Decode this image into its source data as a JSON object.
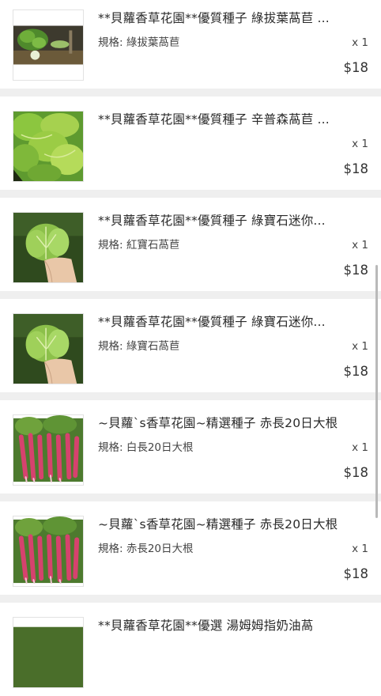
{
  "items": [
    {
      "title": "**貝蘿香草花園**優質種子 綠拔葉萵苣 ...",
      "spec": "規格: 綠拔葉萵苣",
      "qty": "x 1",
      "price": "$18",
      "image_icon": "green-leaf-lettuce-photo"
    },
    {
      "title": "**貝蘿香草花園**優質種子 辛普森萵苣 ...",
      "spec": "",
      "qty": "x 1",
      "price": "$18",
      "image_icon": "simpson-lettuce-photo"
    },
    {
      "title": "**貝蘿香草花園**優質種子 綠寶石迷你...",
      "spec": "規格: 紅寶石萵苣",
      "qty": "x 1",
      "price": "$18",
      "image_icon": "mini-romaine-photo"
    },
    {
      "title": "**貝蘿香草花園**優質種子 綠寶石迷你...",
      "spec": "規格: 綠寶石萵苣",
      "qty": "x 1",
      "price": "$18",
      "image_icon": "mini-romaine-photo"
    },
    {
      "title": "~貝蘿`s香草花園~精選種子 赤長20日大根",
      "spec": "規格: 白長20日大根",
      "qty": "x 1",
      "price": "$18",
      "image_icon": "red-radish-photo"
    },
    {
      "title": "~貝蘿`s香草花園~精選種子 赤長20日大根",
      "spec": "規格: 赤長20日大根",
      "qty": "x 1",
      "price": "$18",
      "image_icon": "red-radish-photo"
    },
    {
      "title": "**貝蘿香草花園**優選 湯姆姆指奶油萵",
      "spec": "",
      "qty": "",
      "price": "",
      "image_icon": "lettuce-photo"
    }
  ],
  "colors": {
    "background": "#efefef",
    "card": "#ffffff",
    "text": "#2a2a2a"
  }
}
